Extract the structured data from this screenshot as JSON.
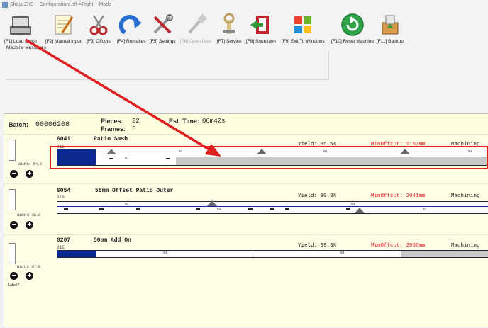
{
  "window": {
    "app_name": "Shaja ZXS",
    "config_label": "ConfigurationLeft->Right",
    "mode_label": "Mode"
  },
  "toolbar": {
    "buttons": [
      {
        "label": "[F1] Load Batch",
        "icon": "folder-tray-icon",
        "enabled": true
      },
      {
        "label": "[F2] Manual Input",
        "icon": "notepad-icon",
        "enabled": true
      },
      {
        "label": "[F3] Offcuts",
        "icon": "scissors-icon",
        "enabled": true
      },
      {
        "label": "[F4] Remakes",
        "icon": "redo-arrow-icon",
        "enabled": true
      },
      {
        "label": "[F5] Settings",
        "icon": "tools-icon",
        "enabled": true
      },
      {
        "label": "[F6] Open Door",
        "icon": "brush-icon",
        "enabled": false
      },
      {
        "label": "[F7] Service",
        "icon": "wrench-icon",
        "enabled": true
      },
      {
        "label": "[F8] Shutdown",
        "icon": "exit-door-icon",
        "enabled": true
      },
      {
        "label": "[F9] Exit To Windows",
        "icon": "windows-logo-icon",
        "enabled": true
      },
      {
        "label": "[F10] Reset Machine",
        "icon": "reset-circle-icon",
        "enabled": true
      },
      {
        "label": "[F11] Backup",
        "icon": "backup-box-icon",
        "enabled": true
      }
    ],
    "machine_messages_label": "Machine Messages"
  },
  "batch": {
    "batch_label": "Batch:",
    "batch_number": "00006208",
    "pieces_label": "Pieces:",
    "pieces_value": "22",
    "frames_label": "Frames:",
    "frames_value": "5",
    "est_time_label": "Est. Time:",
    "est_time_value": "06m42s"
  },
  "rows": [
    {
      "code": "6041",
      "sub": "016",
      "description": "Patio Sash",
      "yield": "Yield: 95.5%",
      "min_offcut": "MinOffcut: 1157mm",
      "machining": "Machining",
      "width": "Width: 54.0",
      "bar_seg": "01"
    },
    {
      "code": "6054",
      "sub": "016",
      "description": "55mm Offset Patio Outer",
      "yield": "Yield: 90.8%",
      "min_offcut": "MinOffcut: 2041mm",
      "machining": "Machining",
      "width": "Width: 88.0",
      "bar_seg": "01"
    },
    {
      "code": "0207",
      "sub": "016",
      "description": "50mm Add On",
      "yield": "Yield: 99.3%",
      "min_offcut": "MinOffcut: 2036mm",
      "machining": "Machining",
      "width": "Width: 87.0",
      "bar_seg": "01"
    }
  ],
  "footer": {
    "label7": "Label7"
  },
  "colors": {
    "bar_fill": "#0b2a8f",
    "min_offcut_text": "#dd2222",
    "highlight": "#e02020",
    "panel_bg": "#fffde6"
  }
}
